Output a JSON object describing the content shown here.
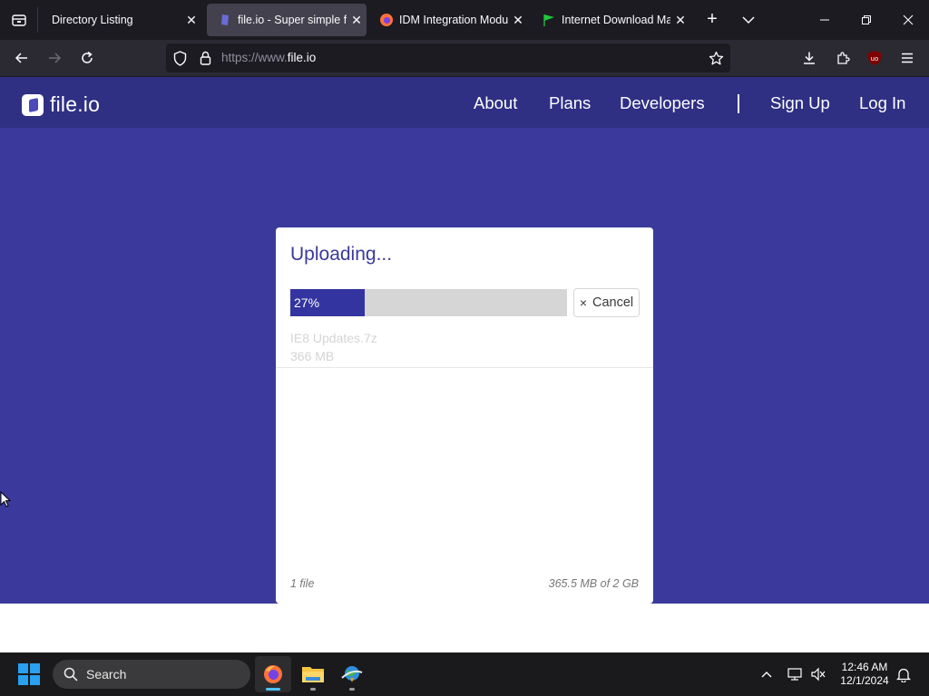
{
  "browser": {
    "tabs": [
      {
        "title": "Directory Listing",
        "active": false
      },
      {
        "title": "file.io - Super simple fil",
        "active": true
      },
      {
        "title": "IDM Integration Modul",
        "active": false
      },
      {
        "title": "Internet Download Ma",
        "active": false
      }
    ],
    "new_tab": "+",
    "close_glyph": "✕",
    "url_protocol": "https://www.",
    "url_domain": "file.io",
    "extension_badge": "3"
  },
  "site": {
    "logo_text": "file.io",
    "nav": [
      "About",
      "Plans",
      "Developers",
      "Sign Up",
      "Log In"
    ]
  },
  "upload": {
    "title": "Uploading...",
    "progress_percent": 27,
    "progress_label": "27%",
    "cancel_label": "Cancel",
    "cancel_icon": "×",
    "file_name": "IE8 Updates.7z",
    "file_size": "366 MB",
    "file_count": "1 file",
    "total_usage": "365.5 MB of 2 GB"
  },
  "taskbar": {
    "search_label": "Search",
    "time": "12:46 AM",
    "date": "12/1/2024"
  },
  "colors": {
    "page_bg": "#3b3a9c",
    "header_bg": "#2f2f84",
    "progress_fill": "#3434a0",
    "accent": "#2aa0f0"
  }
}
